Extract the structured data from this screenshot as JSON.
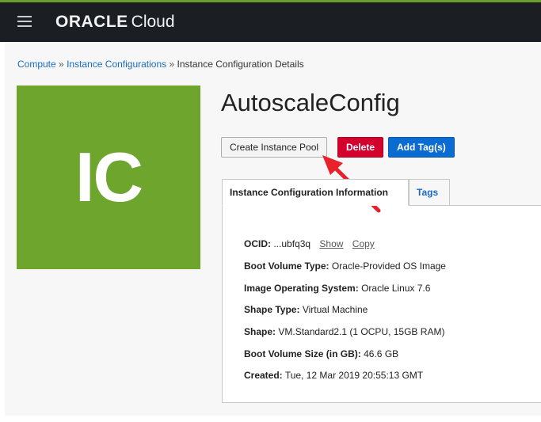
{
  "header": {
    "brand_oracle": "ORACLE",
    "brand_cloud": "Cloud",
    "accent_color": "#6d9e2d",
    "bg_color": "#1b1f24"
  },
  "breadcrumb": {
    "compute": "Compute",
    "instance_configurations": "Instance Configurations",
    "separator": "»",
    "current": "Instance Configuration Details"
  },
  "tile": {
    "initials": "IC",
    "color": "#6ea52c"
  },
  "page": {
    "title": "AutoscaleConfig"
  },
  "actions": {
    "create_pool": "Create Instance Pool",
    "delete": "Delete",
    "add_tags": "Add Tag(s)"
  },
  "tabs": {
    "info": "Instance Configuration Information",
    "tags": "Tags"
  },
  "details": {
    "ocid_label": "OCID:",
    "ocid_value": "...ubfq3q",
    "show": "Show",
    "copy": "Copy",
    "boot_volume_type_label": "Boot Volume Type:",
    "boot_volume_type_value": "Oracle-Provided OS Image",
    "image_os_label": "Image Operating System:",
    "image_os_value": "Oracle Linux 7.6",
    "shape_type_label": "Shape Type:",
    "shape_type_value": "Virtual Machine",
    "shape_label": "Shape:",
    "shape_value": "VM.Standard2.1 (1 OCPU, 15GB RAM)",
    "boot_volume_size_label": "Boot Volume Size (in GB):",
    "boot_volume_size_value": "46.6 GB",
    "created_label": "Created:",
    "created_value": "Tue, 12 Mar 2019 20:55:13 GMT"
  },
  "annotation": {
    "arrow_color": "#e8212b"
  }
}
